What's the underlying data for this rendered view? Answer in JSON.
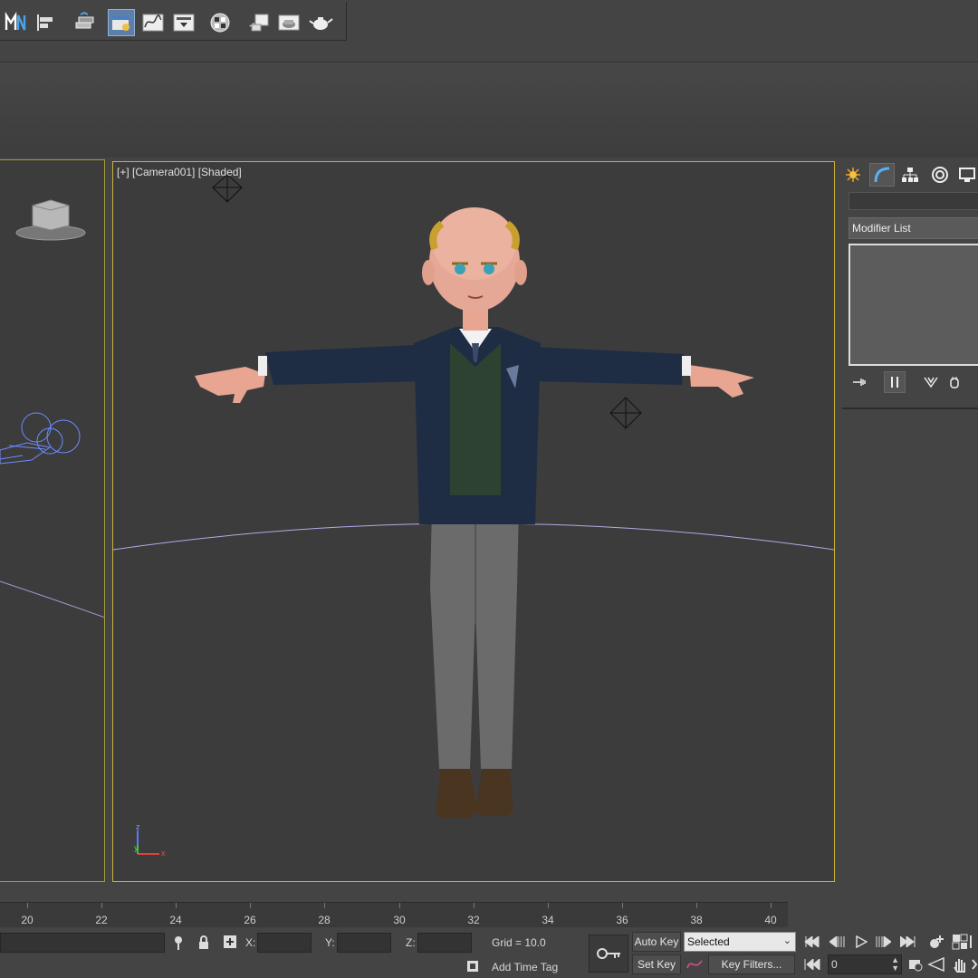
{
  "toolbar": {
    "icons": [
      "mirror-icon",
      "align-icon",
      "layer-manager-icon",
      "scene-explorer-icon",
      "curve-editor-icon",
      "schematic-view-icon",
      "material-editor-icon",
      "render-setup-icon",
      "rendered-frame-window-icon",
      "render-teapot-icon"
    ]
  },
  "viewport": {
    "label": "[+] [Camera001] [Shaded]"
  },
  "command_panel": {
    "tabs": [
      "create-tab",
      "modify-tab",
      "hierarchy-tab",
      "motion-tab",
      "display-tab"
    ],
    "modifier_list": "Modifier List"
  },
  "timeline": {
    "ticks": [
      "20",
      "22",
      "24",
      "26",
      "28",
      "30",
      "32",
      "34",
      "36",
      "38",
      "40"
    ]
  },
  "status": {
    "x_label": "X:",
    "y_label": "Y:",
    "z_label": "Z:",
    "grid": "Grid = 10.0",
    "add_time_tag": "Add Time Tag",
    "auto_key": "Auto Key",
    "set_key": "Set Key",
    "selected": "Selected",
    "key_filters": "Key Filters...",
    "frame": "0"
  },
  "colors": {
    "viewport_border": "#c8b43a",
    "active_button": "#5d7fa8",
    "background": "#444444"
  }
}
